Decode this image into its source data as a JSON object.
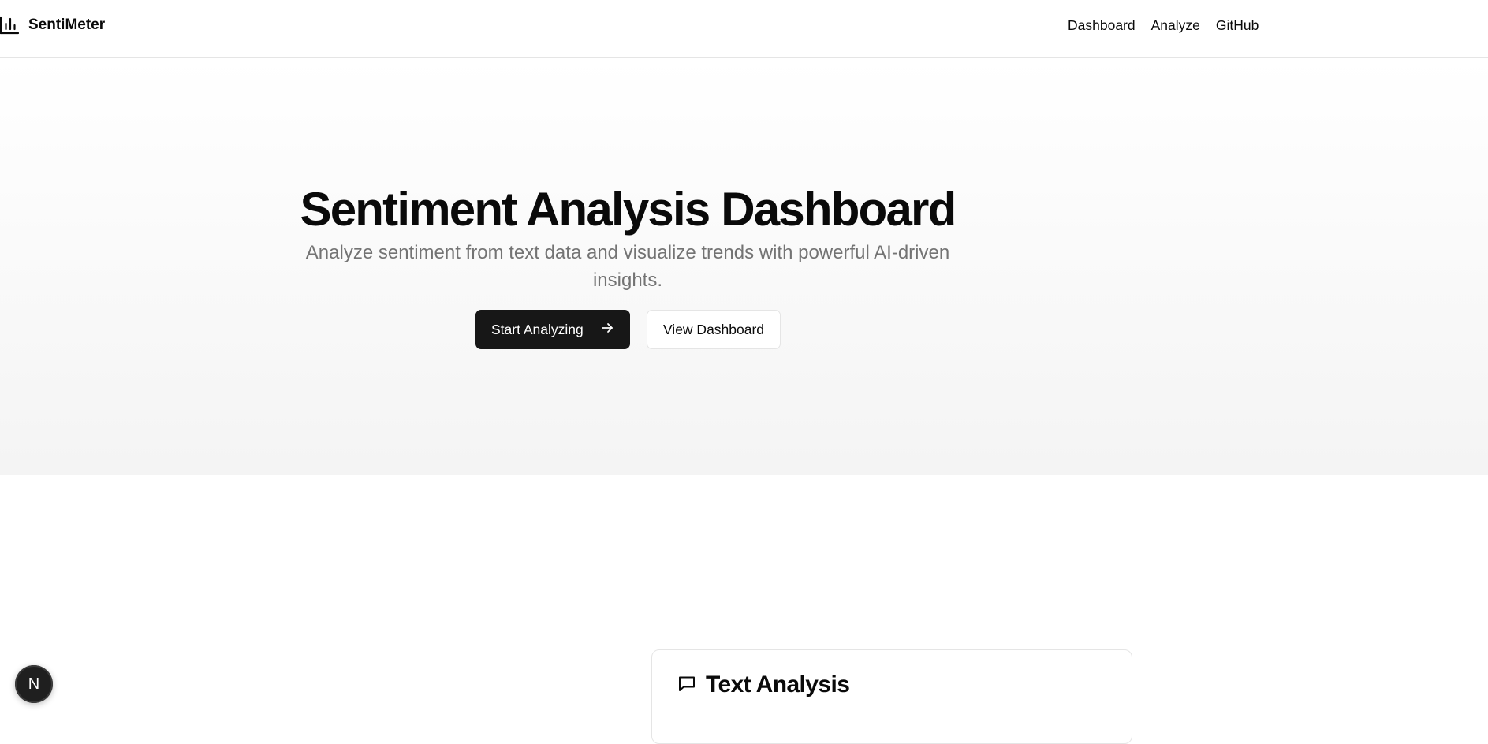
{
  "header": {
    "brand": "SentiMeter",
    "brand_icon": "bar-chart-icon",
    "nav": [
      {
        "label": "Dashboard"
      },
      {
        "label": "Analyze"
      },
      {
        "label": "GitHub"
      }
    ]
  },
  "hero": {
    "title": "Sentiment Analysis Dashboard",
    "subtitle": "Analyze sentiment from text data and visualize trends with powerful AI-driven insights.",
    "primary_button": "Start Analyzing",
    "primary_icon": "arrow-right-icon",
    "secondary_button": "View Dashboard"
  },
  "card": {
    "title": "Text Analysis",
    "icon": "message-square-icon"
  },
  "dev_badge": {
    "letter": "N",
    "icon": "nextjs-icon"
  },
  "colors": {
    "primary": "#171717",
    "muted_text": "#737373",
    "border": "#e5e5e5",
    "background": "#ffffff"
  }
}
